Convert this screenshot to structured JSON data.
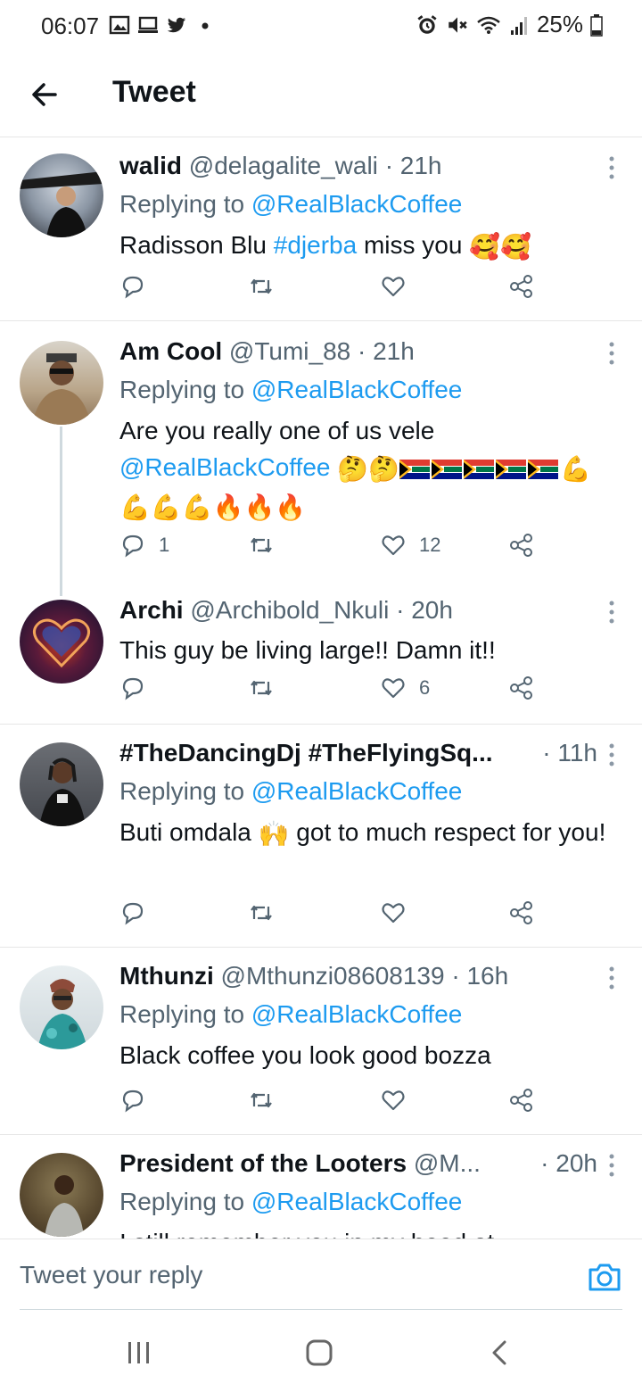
{
  "status_bar": {
    "time": "06:07",
    "battery": "25%",
    "left_icons": [
      "gallery-icon",
      "cast-icon",
      "twitter-icon",
      "dot-icon"
    ],
    "right_icons": [
      "alarm-icon",
      "mute-icon",
      "wifi-icon",
      "signal-icon",
      "battery-icon"
    ]
  },
  "header": {
    "title": "Tweet",
    "back_icon": "arrow-left-icon"
  },
  "tweets": [
    {
      "name": "walid",
      "handle": "@delagalite_wali",
      "time": "· 21h",
      "replying_prefix": "Replying to ",
      "replying_to": "@RealBlackCoffee",
      "text_a": "Radisson Blu ",
      "hashtag": "#djerba",
      "text_b": " miss you ",
      "emojis": "🥰🥰",
      "reply_count": "",
      "like_count": ""
    },
    {
      "name": "Am Cool",
      "handle": "@Tumi_88",
      "time": "· 21h",
      "replying_prefix": "Replying to ",
      "replying_to": "@RealBlackCoffee",
      "text_a": "Are you really one of us vele",
      "mention": "@RealBlackCoffee",
      "emojis_a": "🤔🤔",
      "emojis_b": "💪",
      "emojis_c": "💪💪💪🔥🔥🔥",
      "reply_count": "1",
      "like_count": "12"
    },
    {
      "name": "Archi",
      "handle": "@Archibold_Nkuli",
      "time": "· 20h",
      "text_a": "This guy be living large!! Damn it!!",
      "reply_count": "",
      "like_count": "6"
    },
    {
      "name": "#TheDancingDj #TheFlyingSq...",
      "handle": "",
      "time": "· 11h",
      "replying_prefix": "Replying to ",
      "replying_to": "@RealBlackCoffee",
      "text_a": "Buti omdala ",
      "emojis": "🙌",
      "text_b": " got to much respect for you!",
      "reply_count": "",
      "like_count": ""
    },
    {
      "name": "Mthunzi",
      "handle": "@Mthunzi08608139",
      "time": "· 16h",
      "replying_prefix": "Replying to ",
      "replying_to": "@RealBlackCoffee",
      "text_a": "Black coffee you look good bozza",
      "reply_count": "",
      "like_count": ""
    },
    {
      "name": "President of the Looters",
      "handle": "@M...",
      "time": "· 20h",
      "replying_prefix": "Replying to ",
      "replying_to": "@RealBlackCoffee",
      "text_a": "I still remember you in my hood at"
    }
  ],
  "reply_bar": {
    "placeholder": "Tweet your reply",
    "camera_icon": "camera-icon"
  },
  "nav_bar": {
    "icons": [
      "recent-apps-icon",
      "home-icon",
      "back-icon"
    ]
  },
  "colors": {
    "accent": "#1d9bf0",
    "text": "#0f1419",
    "secondary": "#536471",
    "border": "#e6e6e6"
  }
}
